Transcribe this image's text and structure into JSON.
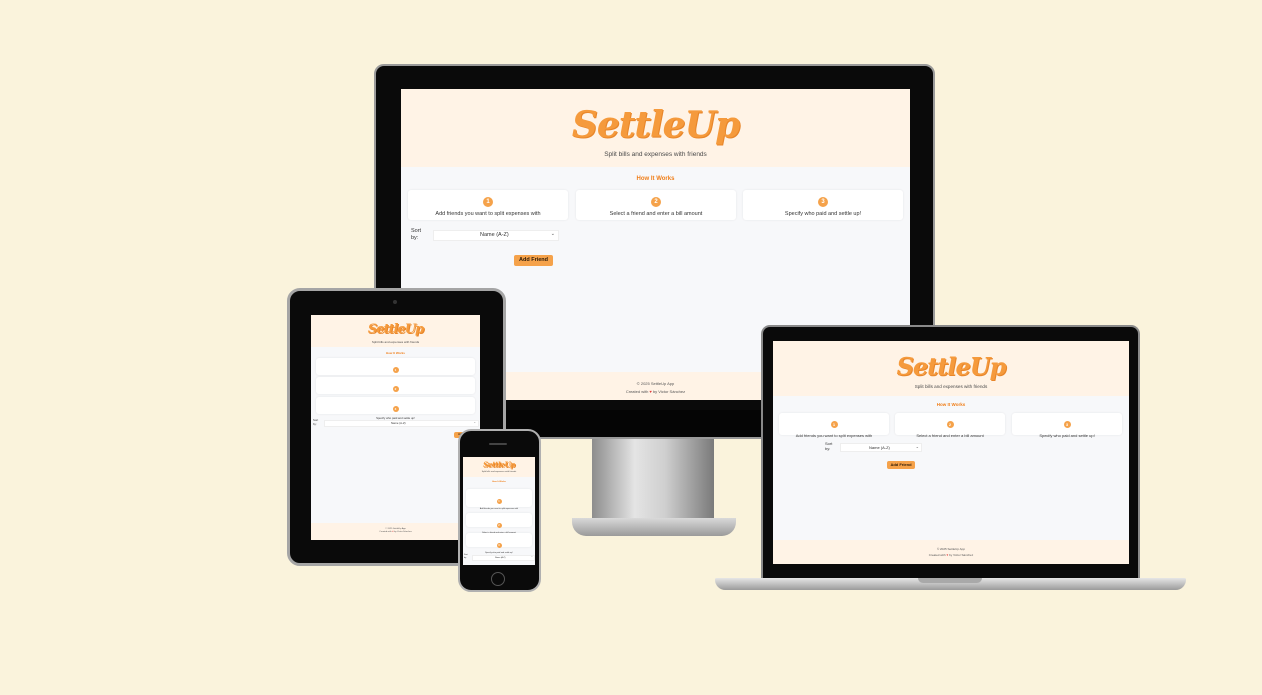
{
  "app": {
    "logo": "SettleUp",
    "tagline": "Split bills and expenses with friends",
    "section_title": "How It Works",
    "steps": [
      {
        "num": "1",
        "text": "Add friends you want to split expenses with"
      },
      {
        "num": "2",
        "text": "Select a friend and enter a bill amount"
      },
      {
        "num": "3",
        "text": "Specify who paid and settle up!"
      }
    ],
    "sort_label": "Sort by:",
    "sort_selected": "Name (A-Z)",
    "add_button": "Add Friend",
    "footer_copyright": "© 2025 SettleUp App",
    "footer_created": "Created with",
    "footer_heart": "♥",
    "footer_author": "by Victor Sánchez"
  },
  "colors": {
    "background": "#faf3dc",
    "accent": "#f59a3c",
    "header_bg": "#fff3e6",
    "button": "#f5a24a"
  },
  "devices": [
    "desktop-monitor",
    "laptop",
    "tablet",
    "phone"
  ]
}
